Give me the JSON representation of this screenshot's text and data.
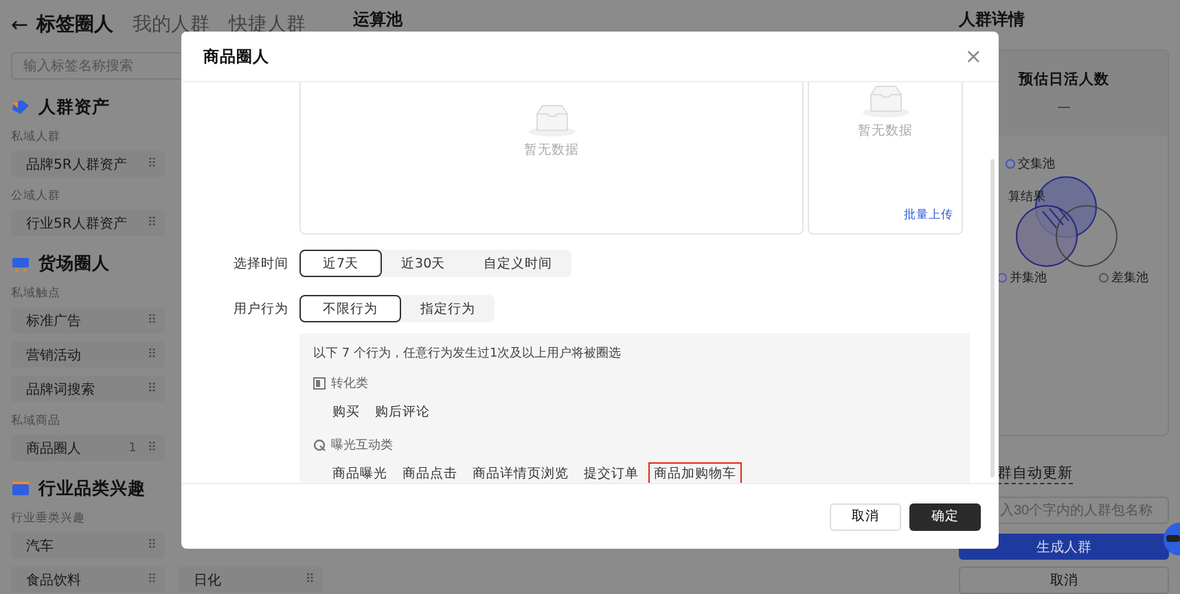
{
  "nav": {
    "back_icon": "←",
    "tabs": [
      {
        "label": "标签圈人",
        "selected": true
      },
      {
        "label": "我的人群",
        "selected": false
      },
      {
        "label": "快捷人群",
        "selected": false
      }
    ]
  },
  "search": {
    "placeholder": "输入标签名称搜索"
  },
  "sections": [
    {
      "title": "人群资产",
      "kind": "asset",
      "groups": [
        {
          "label": "私域人群",
          "rows": [
            [
              {
                "label": "品牌5R人群资产",
                "handle": "⠿"
              }
            ]
          ]
        },
        {
          "label": "公域人群",
          "rows": [
            [
              {
                "label": "行业5R人群资产",
                "handle": "⠿"
              }
            ]
          ]
        }
      ]
    },
    {
      "title": "货场圈人",
      "kind": "cart",
      "groups": [
        {
          "label": "私域触点",
          "rows": [
            [
              {
                "label": "标准广告",
                "handle": "⠿"
              }
            ],
            [
              {
                "label": "营销活动",
                "handle": "⠿"
              }
            ],
            [
              {
                "label": "品牌词搜索",
                "handle": "⠿"
              }
            ]
          ]
        },
        {
          "label": "私域商品",
          "rows": [
            [
              {
                "label": "商品圈人",
                "count": "1",
                "handle": "⠿"
              }
            ]
          ]
        }
      ]
    },
    {
      "title": "行业品类兴趣",
      "kind": "folder",
      "groups": [
        {
          "label": "行业垂类兴趣",
          "rows": [
            [
              {
                "label": "汽车",
                "handle": "⠿"
              }
            ],
            [
              {
                "label": "食品饮料",
                "handle": "⠿"
              },
              {
                "label": "日化",
                "handle": "⠿"
              }
            ]
          ]
        }
      ]
    }
  ],
  "pool": {
    "title": "运算池"
  },
  "detail": {
    "title": "人群详情",
    "metric_label": "预估日活人数",
    "metric_value": "—",
    "venn_labels": [
      {
        "text": "交集池",
        "color": "#3a56c8",
        "kind": "intersect"
      },
      {
        "text": "算结果",
        "kind": "result"
      },
      {
        "text": "并集池",
        "color": "#5a4fc0",
        "kind": "union"
      },
      {
        "text": "差集池",
        "color": "#555555",
        "kind": "diff"
      }
    ],
    "auto_update": "群自动更新",
    "name_placeholder": "入30个字内的人群包名称",
    "generate": "生成人群",
    "cancel": "取消"
  },
  "modal": {
    "title": "商品圈人",
    "close": "×",
    "upload_boxes": [
      {
        "empty_text": "暂无数据"
      },
      {
        "empty_text": "暂无数据",
        "link": "批量上传"
      }
    ],
    "time": {
      "label": "选择时间",
      "options": [
        {
          "label": "近7天",
          "selected": true
        },
        {
          "label": "近30天",
          "selected": false
        },
        {
          "label": "自定义时间",
          "selected": false
        }
      ]
    },
    "behavior": {
      "label": "用户行为",
      "options": [
        {
          "label": "不限行为",
          "selected": true
        },
        {
          "label": "指定行为",
          "selected": false
        }
      ]
    },
    "behavior_note": "以下 7 个行为，任意行为发生过1次及以上用户将被圈选",
    "categories": [
      {
        "title": "转化类",
        "kind": "conversion",
        "items": [
          {
            "label": "购买",
            "highlighted": false
          },
          {
            "label": "购后评论",
            "highlighted": false
          }
        ]
      },
      {
        "title": "曝光互动类",
        "kind": "exposure",
        "items": [
          {
            "label": "商品曝光",
            "highlighted": false
          },
          {
            "label": "商品点击",
            "highlighted": false
          },
          {
            "label": "商品详情页浏览",
            "highlighted": false
          },
          {
            "label": "提交订单",
            "highlighted": false
          },
          {
            "label": "商品加购物车",
            "highlighted": true
          }
        ]
      }
    ],
    "cancel": "取消",
    "confirm": "确定"
  }
}
